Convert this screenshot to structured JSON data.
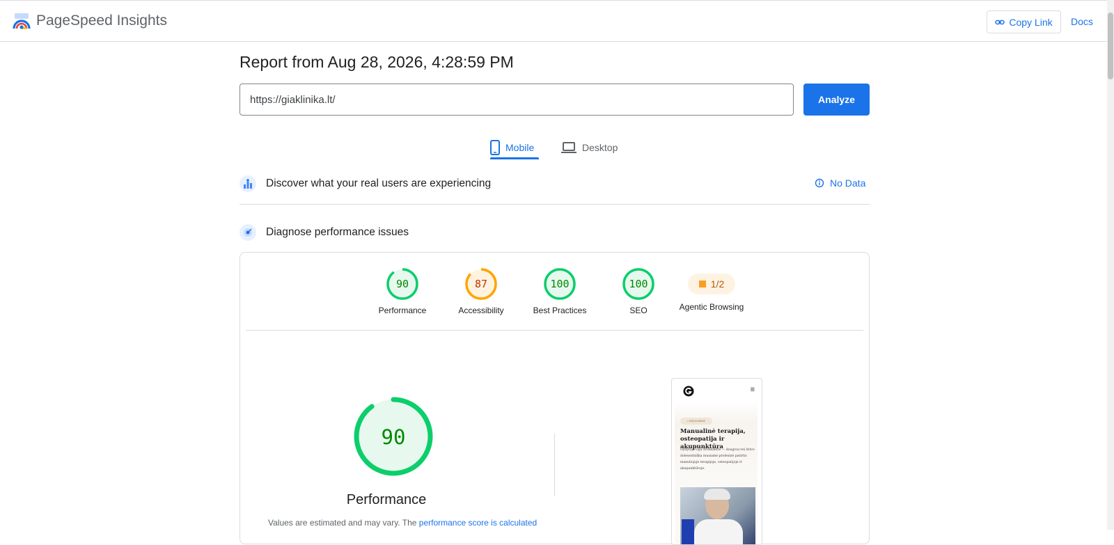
{
  "header": {
    "brand": "PageSpeed Insights",
    "copy_link": "Copy Link",
    "docs": "Docs"
  },
  "report": {
    "title": "Report from Aug 28, 2026, 4:28:59 PM",
    "url_value": "https://giaklinika.lt/",
    "analyze_label": "Analyze"
  },
  "tabs": [
    {
      "label": "Mobile",
      "active": true,
      "icon": "phone-icon"
    },
    {
      "label": "Desktop",
      "active": false,
      "icon": "laptop-icon"
    }
  ],
  "real_users": {
    "title": "Discover what your real users are experiencing",
    "status": "No Data",
    "icon": "crux-chart-icon"
  },
  "diagnose": {
    "title": "Diagnose performance issues",
    "icon": "lighthouse-icon"
  },
  "scores": [
    {
      "label": "Performance",
      "value": "90",
      "color": "#0cce6b",
      "text_color": "#008800",
      "fill": "#e7f9ee",
      "fraction": 0.9
    },
    {
      "label": "Accessibility",
      "value": "87",
      "color": "#ffa400",
      "text_color": "#c33300",
      "fill": "#fff3e0",
      "fraction": 0.87
    },
    {
      "label": "Best Practices",
      "value": "100",
      "color": "#0cce6b",
      "text_color": "#008800",
      "fill": "#e7f9ee",
      "fraction": 1.0
    },
    {
      "label": "SEO",
      "value": "100",
      "color": "#0cce6b",
      "text_color": "#008800",
      "fill": "#e7f9ee",
      "fraction": 1.0
    }
  ],
  "agentic": {
    "label": "Agentic Browsing",
    "value": "1/2"
  },
  "performance": {
    "value": "90",
    "fraction": 0.9,
    "label": "Performance",
    "note_prefix": "Values are estimated and may vary. The ",
    "note_link": "performance score is calculated"
  },
  "preview": {
    "tag": "• GIA KLINIKA",
    "heading": "Manualinė terapija, osteopatija ir akupunktūra",
    "paragraph": "Gydytoja Gija Aroksladre — dougvuo tei ititvo doleseztniška musiamė profesinė patirtis manuliojuje terapijoje, osteopatijoje ir akupunktūroje.",
    "menu_icon": "≡"
  }
}
